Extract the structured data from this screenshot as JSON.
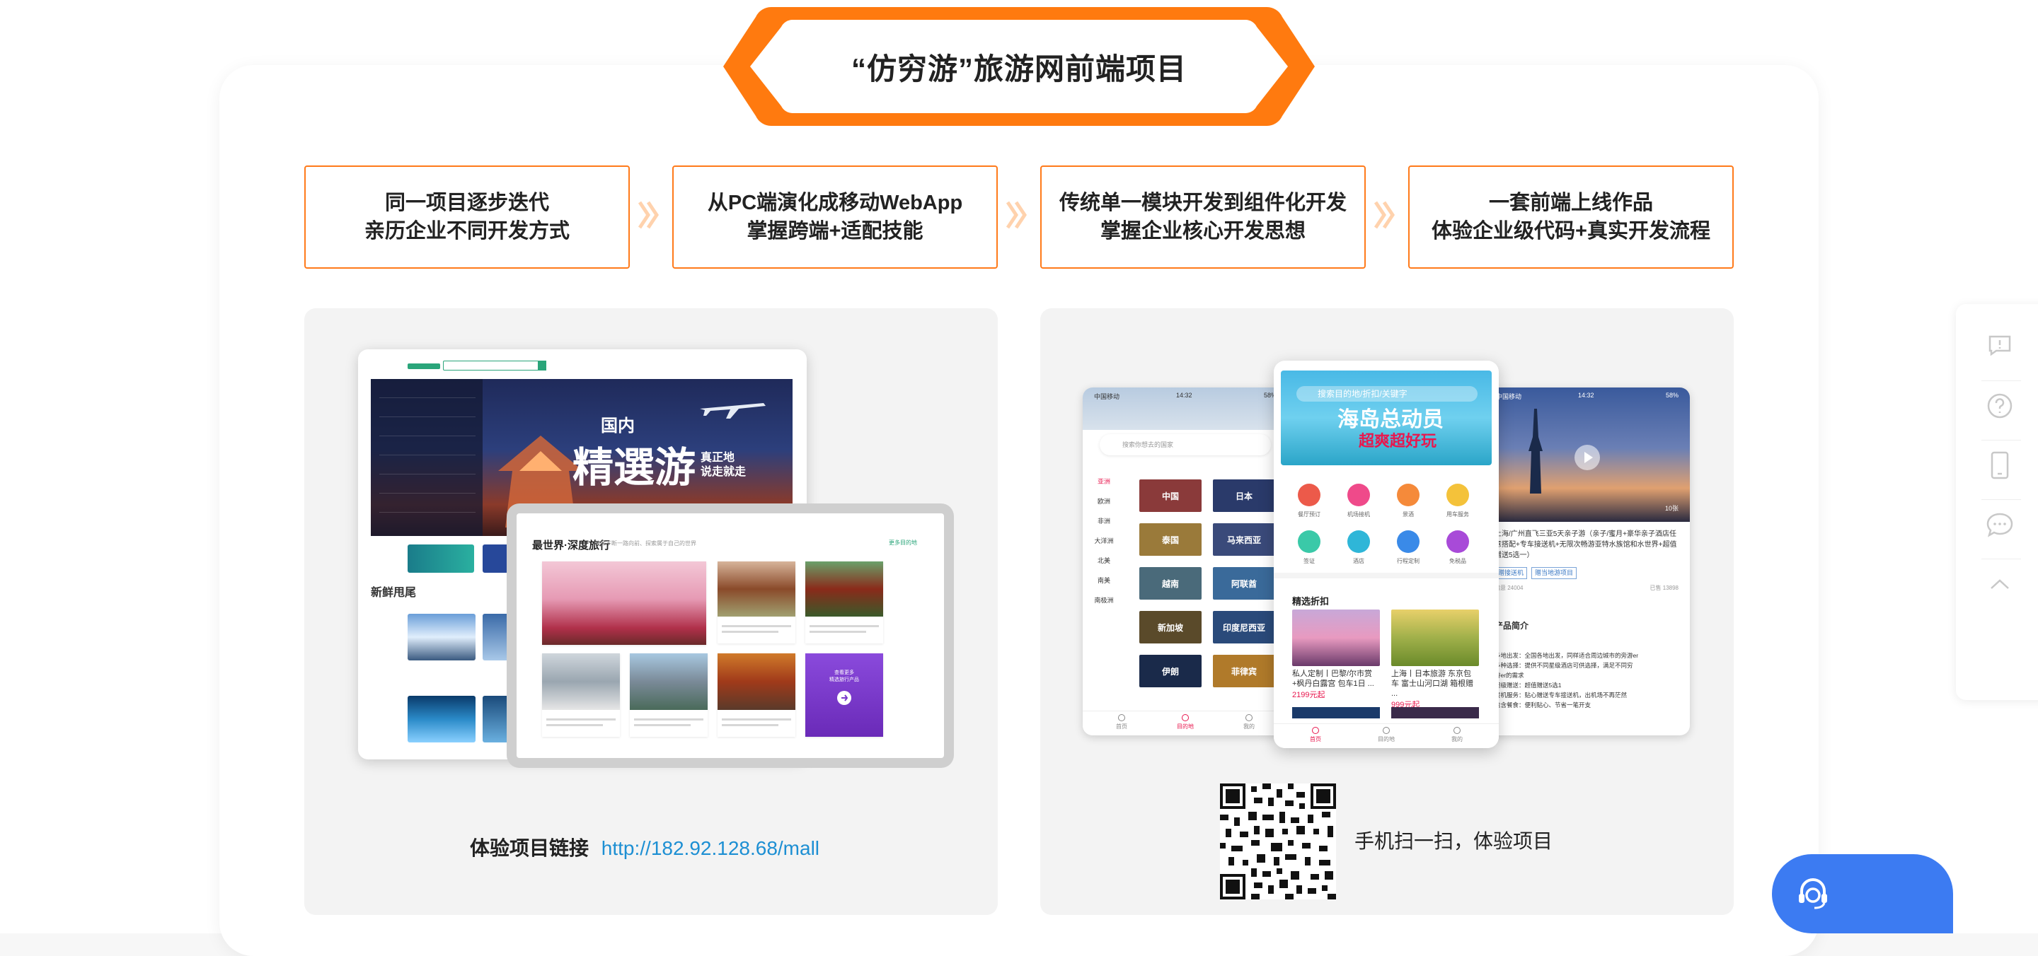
{
  "banner": {
    "title": "“仿穷游”旅游网前端项目"
  },
  "features": [
    {
      "line1": "同一项目逐步迭代",
      "line2": "亲历企业不同开发方式"
    },
    {
      "line1": "从PC端演化成移动WebApp",
      "line2": "掌握跨端+适配技能"
    },
    {
      "line1": "传统单一模块开发到组件化开发",
      "line2": "掌握企业核心开发思想"
    },
    {
      "line1": "一套前端上线作品",
      "line2": "体验企业级代码+真实开发流程"
    }
  ],
  "pc_panel": {
    "hero": {
      "sub": "国内",
      "main": "精選游",
      "side1": "真正地",
      "side2": "说走就走"
    },
    "section_new": "新鲜甩尾",
    "tablet_title": "最世界·深度旅行",
    "tablet_sub": "随探不断一路向前、探索属于自己的世界",
    "tablet_more": "更多目的地",
    "promo_line1": "查看更多",
    "promo_line2": "精选旅行产品",
    "link_label": "体验项目链接",
    "link_url": "http://182.92.128.68/mall"
  },
  "mobile_panel": {
    "mid": {
      "search_placeholder": "搜索目的地/折扣/关键字",
      "banner_title": "海岛总动员",
      "banner_sub": "超爽超好玩",
      "categories": [
        "餐厅预订",
        "机场接机",
        "景酒",
        "用车服务",
        "签证",
        "酒店",
        "行程定制",
        "免税品"
      ],
      "section_title": "精选折扣",
      "deals": [
        {
          "text": "私人定制丨巴黎/尔市赏+枫丹白露宫 包车1日 ...",
          "price": "2199元起"
        },
        {
          "text": "上海丨日本旅游 东京包车 富士山河口湖 箱根赠 ...",
          "price": "999元起"
        }
      ],
      "tabs": [
        "首页",
        "目的地",
        "我的"
      ]
    },
    "left": {
      "status_carrier": "中国移动",
      "status_time": "14:32",
      "status_battery": "58%",
      "search_placeholder": "搜索你想去的国家",
      "regions": [
        "亚洲",
        "欧洲",
        "非洲",
        "大洋洲",
        "北美",
        "南美",
        "南极洲"
      ],
      "countries": [
        "中国",
        "日本",
        "泰国",
        "马来西亚",
        "越南",
        "阿联酋",
        "新加坡",
        "印度尼西亚",
        "伊朗",
        "菲律宾"
      ],
      "tabs": [
        "首页",
        "目的地",
        "我的"
      ]
    },
    "right": {
      "status_carrier": "中国移动",
      "status_time": "14:32",
      "status_battery": "58%",
      "photo_count": "10张",
      "title": "上海/广州直飞三亚5天亲子游（亲子/蜜月+豪华亲子酒店任意搭配+专车接送机+无限次畅游亚特水族馆和水世界+超值赠送5选一）",
      "tag1": "赠接送机",
      "tag2": "赠当地游项目",
      "meta_left": "满意 24004",
      "meta_right": "已售 13898",
      "section": "产品简介",
      "desc": [
        "多地出发：全国各地出发，同样适合周边城市的旁游er",
        "多种选择：提供不同星级酒店可供选择，满足不同穷",
        "游er的需求",
        "超级赠送：超值赠送5选1",
        "接机服务：贴心赠送专车接送机，出机场不再茫然",
        "包含餐食：便利贴心、节省一笔开支"
      ]
    },
    "qr_caption": "手机扫一扫，体验项目"
  },
  "sidebar": {
    "icons": [
      "feedback-icon",
      "help-icon",
      "mobile-icon",
      "chat-bubble-icon",
      "back-to-top-icon"
    ]
  },
  "colors": {
    "accent": "#ff7a1a",
    "link": "#1d8fd3",
    "chat": "#3c7bf2"
  }
}
